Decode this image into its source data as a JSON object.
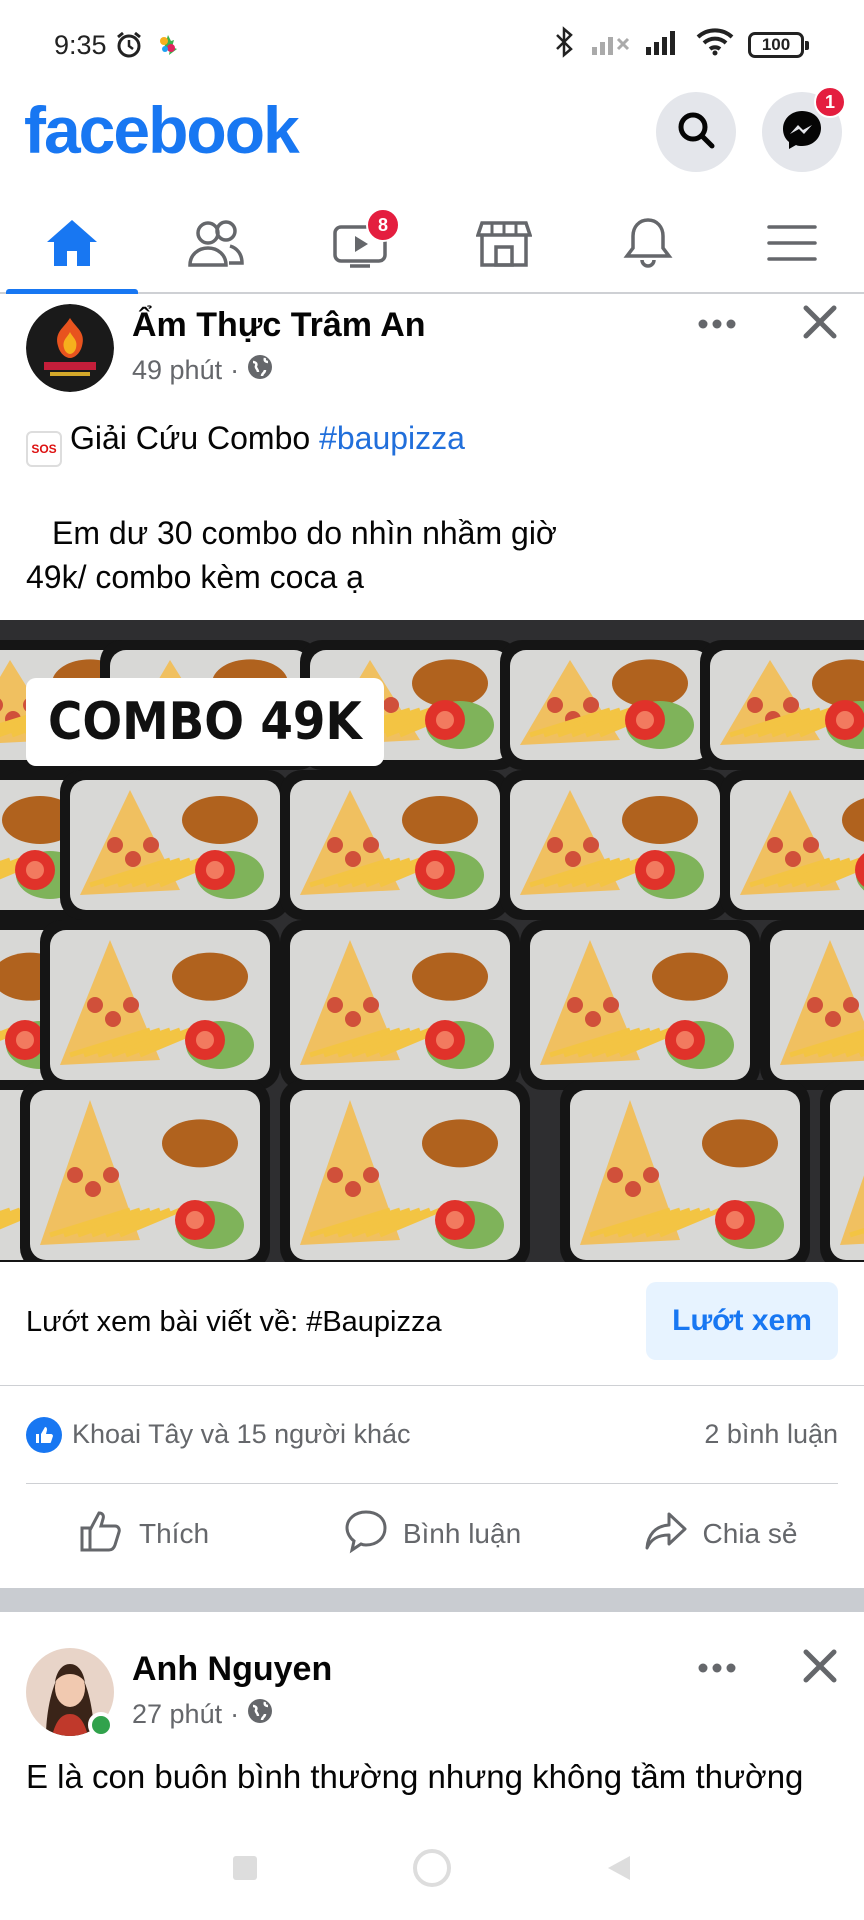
{
  "status_bar": {
    "time": "9:35",
    "battery": "100"
  },
  "header": {
    "logo": "facebook",
    "messenger_badge": "1"
  },
  "nav": {
    "tabs": [
      {
        "name": "home",
        "icon": "home-icon",
        "active": true
      },
      {
        "name": "friends",
        "icon": "friends-icon",
        "active": false
      },
      {
        "name": "watch",
        "icon": "video-icon",
        "active": false,
        "badge": "8"
      },
      {
        "name": "marketplace",
        "icon": "marketplace-icon",
        "active": false
      },
      {
        "name": "notifications",
        "icon": "bell-icon",
        "active": false
      },
      {
        "name": "menu",
        "icon": "hamburger-icon",
        "active": false
      }
    ],
    "watch_badge": "8"
  },
  "post1": {
    "author": "Ẩm Thực Trâm An",
    "time": "49 phút",
    "separator": "·",
    "text_line1_prefix": "Giải Cứu Combo ",
    "hashtag": "#baupizza",
    "text_line2": "Em dư 30 combo do nhìn nhầm giờ",
    "text_line3": "49k/ combo kèm coca ạ",
    "image_label": "COMBO 49K",
    "browse_text": "Lướt xem bài viết về: #Baupizza",
    "browse_button": "Lướt xem",
    "reactions_text": "Khoai Tây và 15 người khác",
    "comments_count": "2 bình luận",
    "actions": {
      "like": "Thích",
      "comment": "Bình luận",
      "share": "Chia sẻ"
    }
  },
  "post2": {
    "author": "Anh Nguyen",
    "time": "27 phút",
    "separator": "·",
    "text_line1": "E là con buôn bình thường nhưng không tầm thường"
  },
  "colors": {
    "brand": "#1877f2",
    "badge": "#e41e3f",
    "online": "#31a24c"
  }
}
